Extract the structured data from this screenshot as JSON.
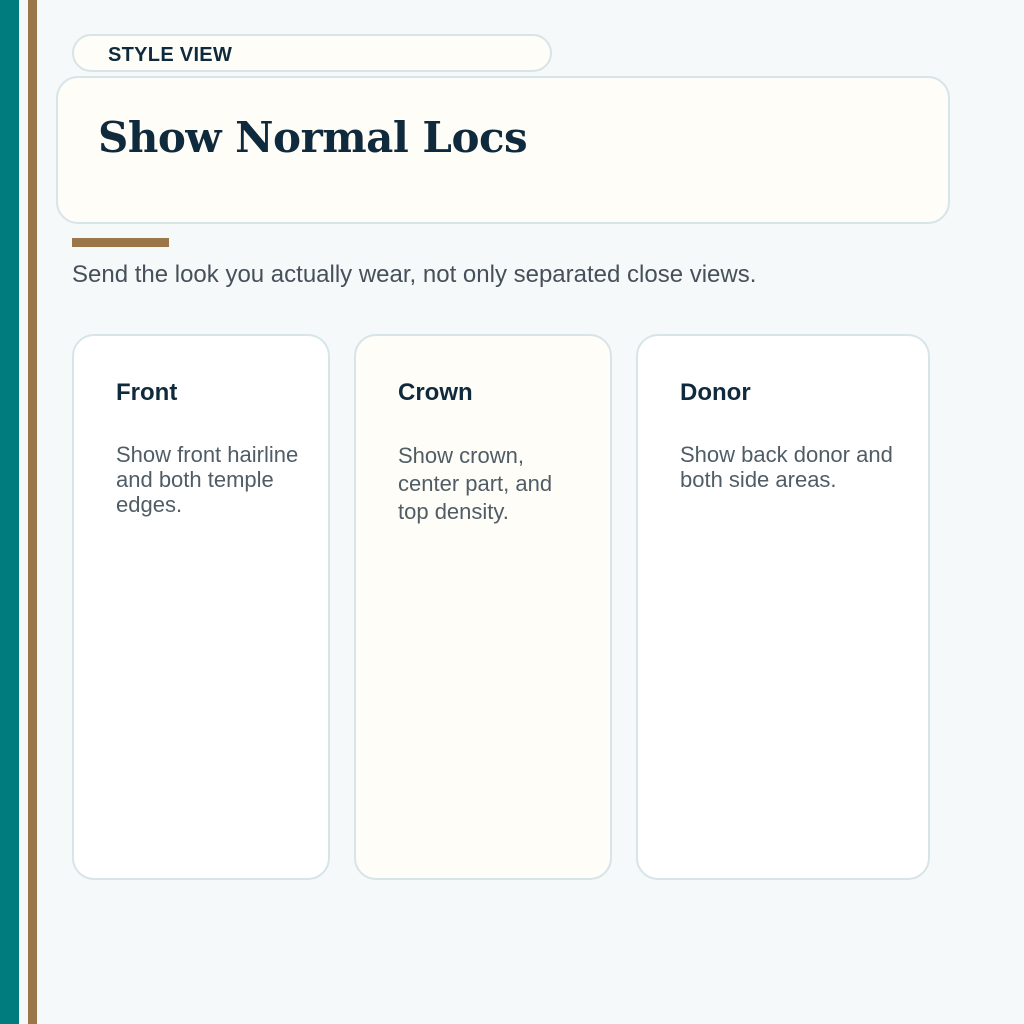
{
  "theme": {
    "rail_primary": "#017c7e",
    "rail_accent": "#9a7649",
    "ink": "#0f2a3c",
    "muted": "#505d66",
    "card_border": "#d7e4e8",
    "cream": "#fefdf8"
  },
  "eyebrow": {
    "label": "STYLE VIEW"
  },
  "hero": {
    "title": "Show Normal Locs"
  },
  "subtitle": "Send the look you actually wear, not only separated close views.",
  "cards": [
    {
      "title": "Front",
      "body": "Show front hairline and both temple edges."
    },
    {
      "title": "Crown",
      "body": "Show crown, center part, and top density."
    },
    {
      "title": "Donor",
      "body": "Show back donor and both side areas."
    }
  ]
}
